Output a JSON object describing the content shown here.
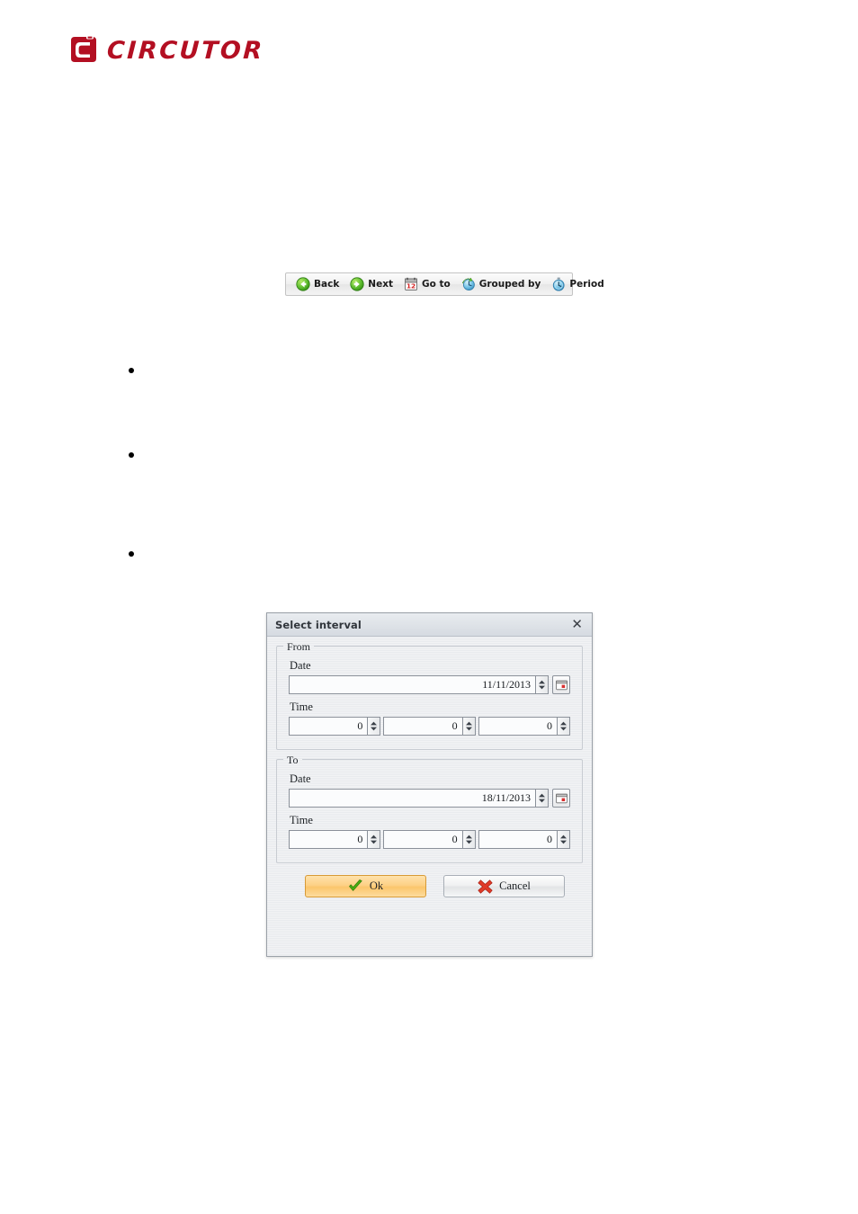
{
  "brand": {
    "name": "CIRCUTOR",
    "logo_color": "#b30f22",
    "logo_icon": "circutor-c-mark-icon"
  },
  "toolbar": {
    "items": [
      {
        "label": "Back",
        "icon": "back-arrow-icon"
      },
      {
        "label": "Next",
        "icon": "next-arrow-icon"
      },
      {
        "label": "Go to",
        "icon": "calendar-icon"
      },
      {
        "label": "Grouped by",
        "icon": "group-clock-icon"
      },
      {
        "label": "Period",
        "icon": "stopwatch-icon"
      }
    ]
  },
  "bullets": [
    {
      "text": ""
    },
    {
      "text": ""
    },
    {
      "text": ""
    }
  ],
  "dialog": {
    "title": "Select interval",
    "close_icon": "close-icon",
    "groups": [
      {
        "legend": "From",
        "date_label": "Date",
        "date_value": "11/11/2013",
        "calendar_icon": "calendar-picker-icon",
        "time_label": "Time",
        "time_values": [
          "0",
          "0",
          "0"
        ]
      },
      {
        "legend": "To",
        "date_label": "Date",
        "date_value": "18/11/2013",
        "calendar_icon": "calendar-picker-icon",
        "time_label": "Time",
        "time_values": [
          "0",
          "0",
          "0"
        ]
      }
    ],
    "buttons": {
      "ok": {
        "label": "Ok",
        "icon": "green-check-icon",
        "accent": "#fbc66c"
      },
      "cancel": {
        "label": "Cancel",
        "icon": "red-cross-icon",
        "accent": "#e64a3b"
      }
    }
  }
}
